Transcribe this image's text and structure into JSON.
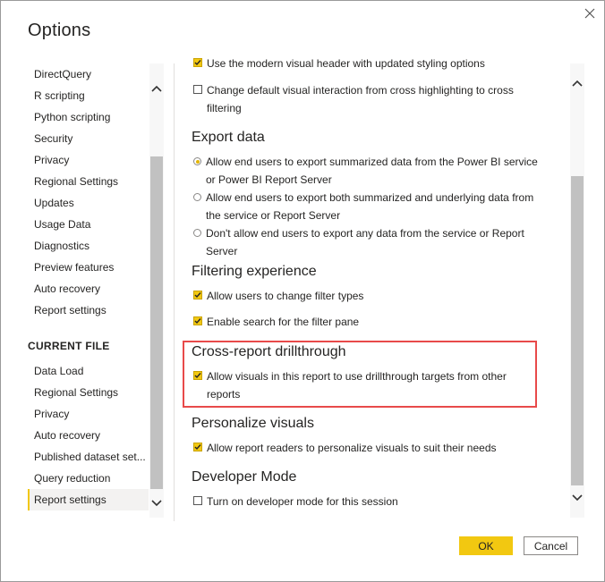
{
  "dialog": {
    "title": "Options"
  },
  "sidebar": {
    "global_items": [
      "DirectQuery",
      "R scripting",
      "Python scripting",
      "Security",
      "Privacy",
      "Regional Settings",
      "Updates",
      "Usage Data",
      "Diagnostics",
      "Preview features",
      "Auto recovery",
      "Report settings"
    ],
    "current_file_header": "CURRENT FILE",
    "current_file_items": [
      "Data Load",
      "Regional Settings",
      "Privacy",
      "Auto recovery",
      "Published dataset set...",
      "Query reduction",
      "Report settings"
    ],
    "active_item": "Report settings"
  },
  "content": {
    "top_options": [
      {
        "label": "Use the modern visual header with updated styling options",
        "checked": true
      },
      {
        "label": "Change default visual interaction from cross highlighting to cross filtering",
        "checked": false
      }
    ],
    "export": {
      "heading": "Export data",
      "options": [
        {
          "label": "Allow end users to export summarized data from the Power BI service or Power BI Report Server",
          "selected": true
        },
        {
          "label": "Allow end users to export both summarized and underlying data from the service or Report Server",
          "selected": false
        },
        {
          "label": "Don't allow end users to export any data from the service or Report Server",
          "selected": false
        }
      ]
    },
    "filtering": {
      "heading": "Filtering experience",
      "options": [
        {
          "label": "Allow users to change filter types",
          "checked": true
        },
        {
          "label": "Enable search for the filter pane",
          "checked": true
        }
      ]
    },
    "drillthrough": {
      "heading": "Cross-report drillthrough",
      "options": [
        {
          "label": "Allow visuals in this report to use drillthrough targets from other reports",
          "checked": true
        }
      ]
    },
    "personalize": {
      "heading": "Personalize visuals",
      "options": [
        {
          "label": "Allow report readers to personalize visuals to suit their needs",
          "checked": true
        }
      ]
    },
    "developer": {
      "heading": "Developer Mode",
      "options": [
        {
          "label": "Turn on developer mode for this session",
          "checked": false
        }
      ]
    }
  },
  "buttons": {
    "ok": "OK",
    "cancel": "Cancel"
  },
  "colors": {
    "accent": "#f2c811",
    "highlight_box": "#e84a4a"
  },
  "icons": [
    "close-icon",
    "chevron-up-icon",
    "chevron-down-icon",
    "checkmark-icon"
  ]
}
